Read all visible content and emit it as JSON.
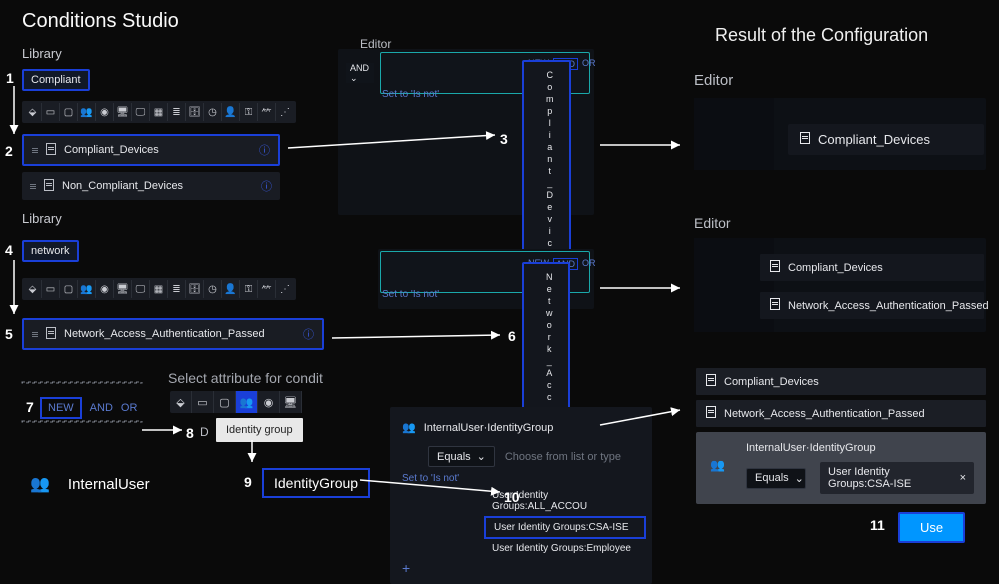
{
  "page_title": "Conditions Studio",
  "result_title": "Result of the Configuration",
  "labels": {
    "editor": "Editor",
    "library": "Library",
    "set_to_isnot": "Set to 'Is not'",
    "select_attr": "Select attribute for condit",
    "dictionary_hint": "D"
  },
  "logic": {
    "new": "NEW",
    "and": "AND",
    "or": "OR",
    "and_caret": "AND ⌄"
  },
  "library1": {
    "search": "Compliant",
    "items": [
      {
        "name": "Compliant_Devices"
      },
      {
        "name": "Non_Compliant_Devices"
      }
    ]
  },
  "library2": {
    "search": "network",
    "items": [
      {
        "name": "Network_Access_Authentication_Passed"
      }
    ]
  },
  "vlabels": {
    "compliant": "Compliant_Devices",
    "netaccess": "Network_Access"
  },
  "attr": {
    "tooltip": "Identity group",
    "dictionary": "InternalUser",
    "attribute": "IdentityGroup"
  },
  "dropdown": {
    "header": "InternalUser·IdentityGroup",
    "operator": "Equals",
    "placeholder": "Choose from list or type",
    "options": [
      "User Identity Groups:ALL_ACCOU",
      "User Identity Groups:CSA-ISE",
      "User Identity Groups:Employee"
    ]
  },
  "results": {
    "r1": "Compliant_Devices",
    "r2": "Compliant_Devices",
    "r3": "Network_Access_Authentication_Passed",
    "r4": "Compliant_Devices",
    "r5": "Network_Access_Authentication_Passed",
    "final_header": "InternalUser·IdentityGroup",
    "final_operator": "Equals",
    "final_value": "User Identity Groups:CSA-ISE",
    "use": "Use"
  },
  "steps": {
    "1": "1",
    "2": "2",
    "3": "3",
    "4": "4",
    "5": "5",
    "6": "6",
    "7": "7",
    "8": "8",
    "9": "9",
    "10": "10",
    "11": "11"
  },
  "icons": {
    "pin": "⬙",
    "card": "▭",
    "sq": "▢",
    "grp": "👥",
    "globe": "◉",
    "mon": "🖥",
    "mon2": "🖵",
    "win": "▦",
    "bars": "≣",
    "db": "🗄",
    "clock": "◷",
    "user": "👤",
    "key": "⚿",
    "tree": "⺮",
    "wifi": "⋰"
  }
}
